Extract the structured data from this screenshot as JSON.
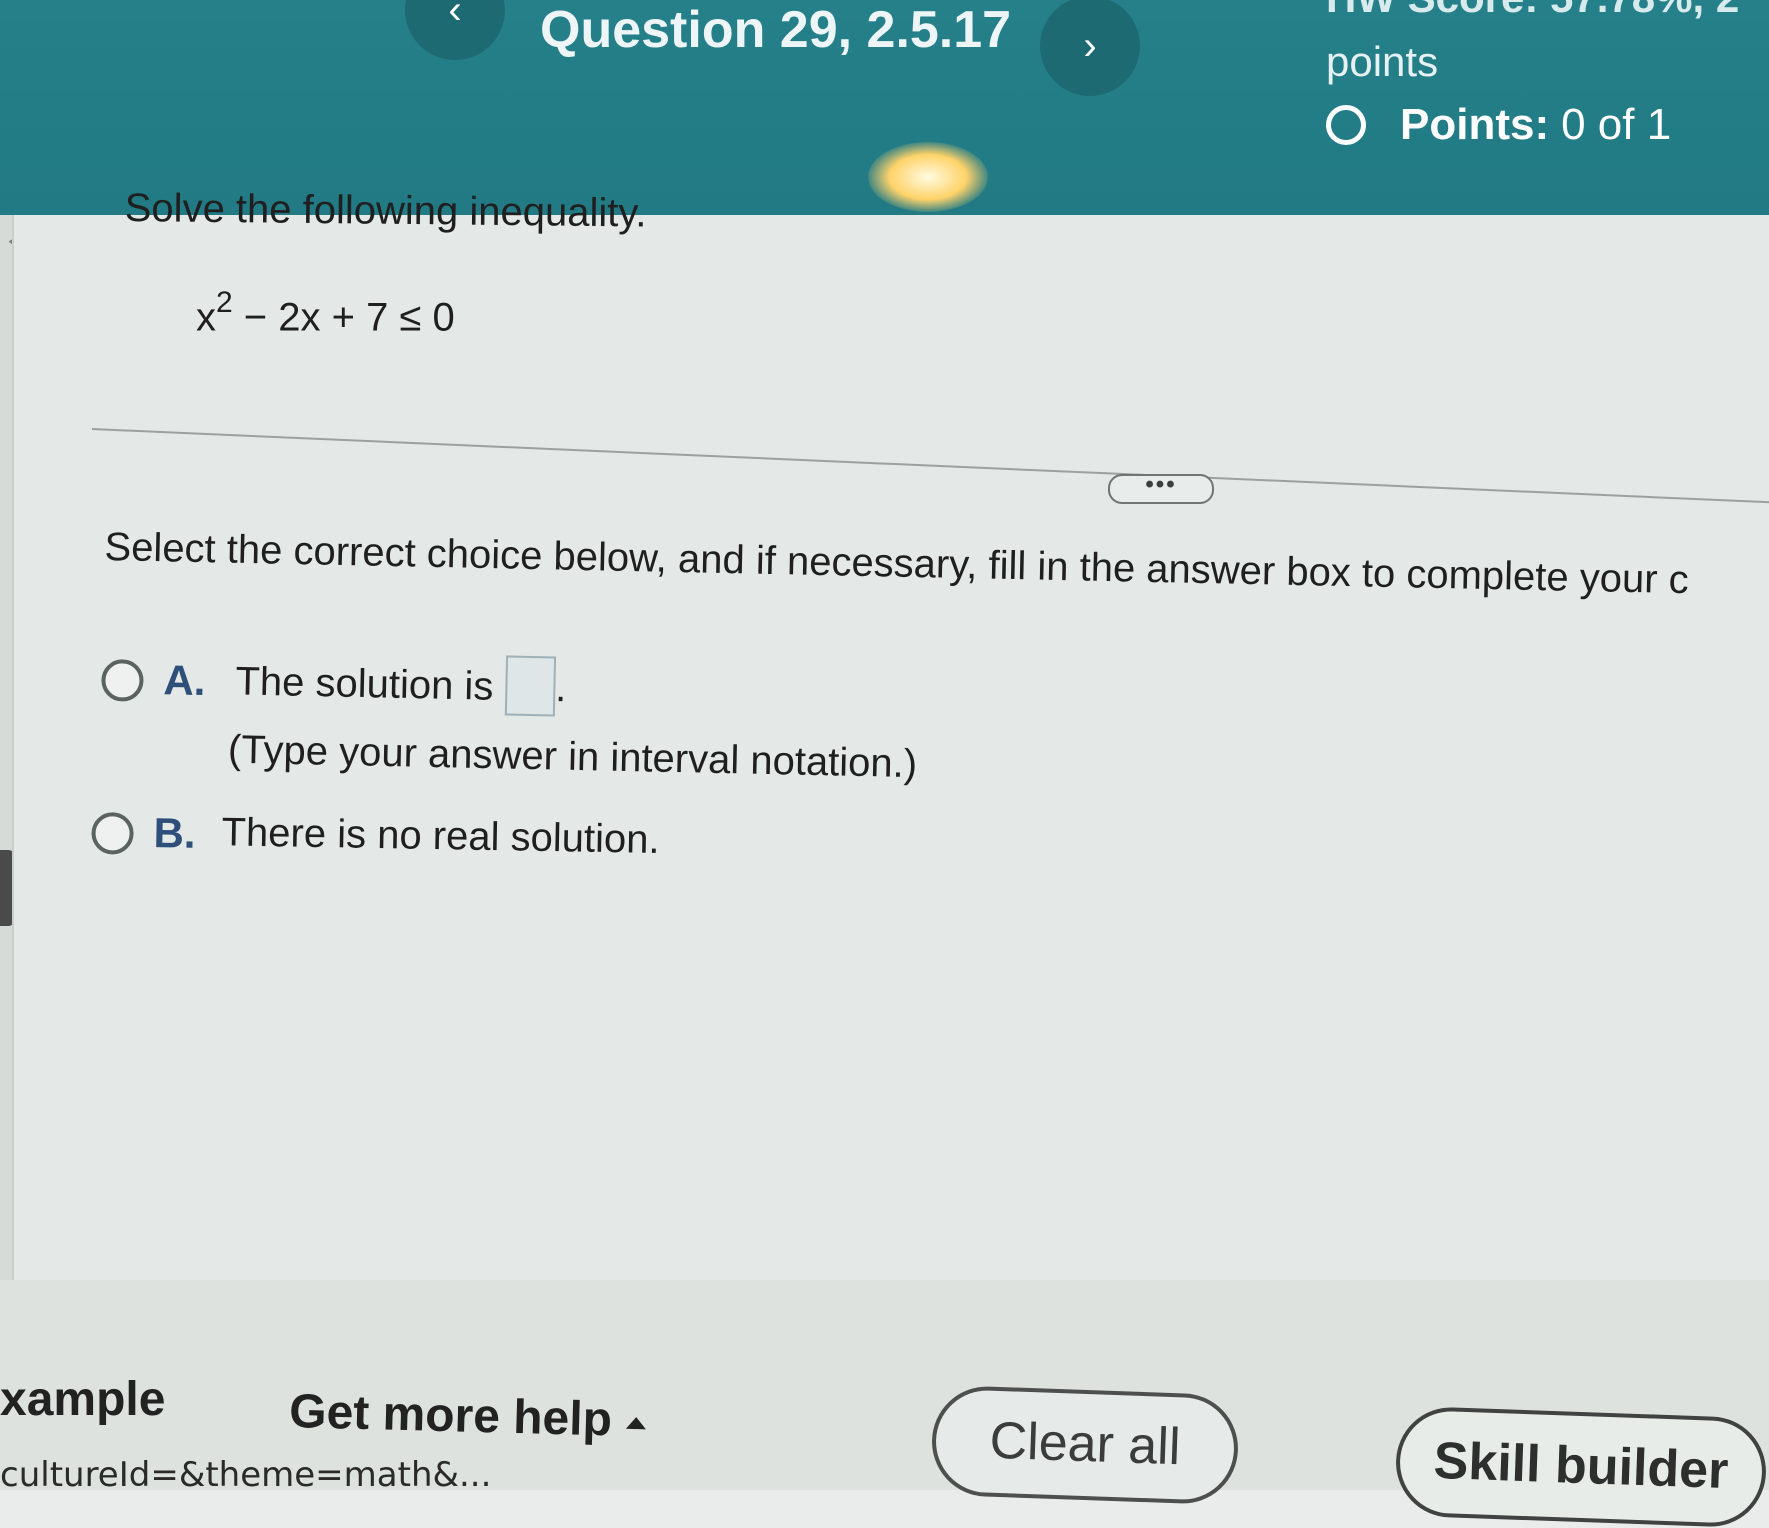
{
  "header": {
    "prev_icon": "chevron-left",
    "next_icon": "chevron-right",
    "prev_glyph": "‹",
    "next_glyph": "›",
    "question_title": "Question 29, 2.5.17",
    "hw_score": "HW Score: 57.78%, 2",
    "hw_points_word": "points",
    "points_label": "Points:",
    "points_value": "0 of 1"
  },
  "question": {
    "prompt": "Solve the following inequality.",
    "equation_base": "x",
    "equation_exponent": "2",
    "equation_rest": " − 2x + 7 ≤ 0",
    "more_label": "•••",
    "instruction": "Select the correct choice below, and if necessary, fill in the answer box to complete your c"
  },
  "choices": [
    {
      "letter": "A.",
      "text": "The solution is",
      "after_box": ".",
      "sub": "(Type your answer in interval notation.)"
    },
    {
      "letter": "B.",
      "text": "There is no real solution."
    }
  ],
  "toolbar": {
    "example_label": "xample",
    "help_label": "Get more help",
    "clear_label": "Clear all",
    "skill_label": "Skill builder",
    "url_fragment": "cultureId=&theme=math&..."
  },
  "colors": {
    "header_teal": "#217a84",
    "choice_letter": "#2d4f7a"
  }
}
